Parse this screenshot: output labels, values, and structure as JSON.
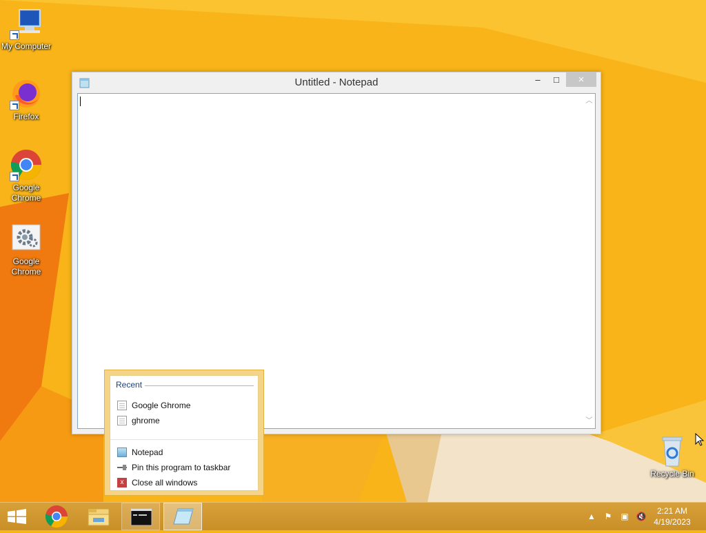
{
  "desktop": {
    "icons": [
      {
        "label": "My Computer",
        "icon": "computer-icon"
      },
      {
        "label": "Firefox",
        "icon": "firefox-icon"
      },
      {
        "label_line1": "Google",
        "label_line2": "Chrome",
        "icon": "chrome-icon"
      },
      {
        "label_line1": "Google",
        "label_line2": "Chrome",
        "icon": "settings-gear-icon"
      },
      {
        "label": "Recycle Bin",
        "icon": "recycle-bin-icon"
      }
    ]
  },
  "window": {
    "title": "Untitled - Notepad",
    "minimize": "–",
    "maximize": "□",
    "close": "×",
    "content": ""
  },
  "jumplist": {
    "section": "Recent",
    "recent": [
      "Google Ghrome",
      "ghrome"
    ],
    "tasks": [
      "Notepad",
      "Pin this program to taskbar",
      "Close all windows"
    ]
  },
  "taskbar": {
    "apps": [
      "start-icon",
      "chrome-icon",
      "file-explorer-icon",
      "command-prompt-icon",
      "notepad-icon"
    ],
    "time": "2:21 AM",
    "date": "4/19/2023"
  },
  "colors": {
    "desktop": "#f7b616",
    "accent": "#e0b040"
  }
}
